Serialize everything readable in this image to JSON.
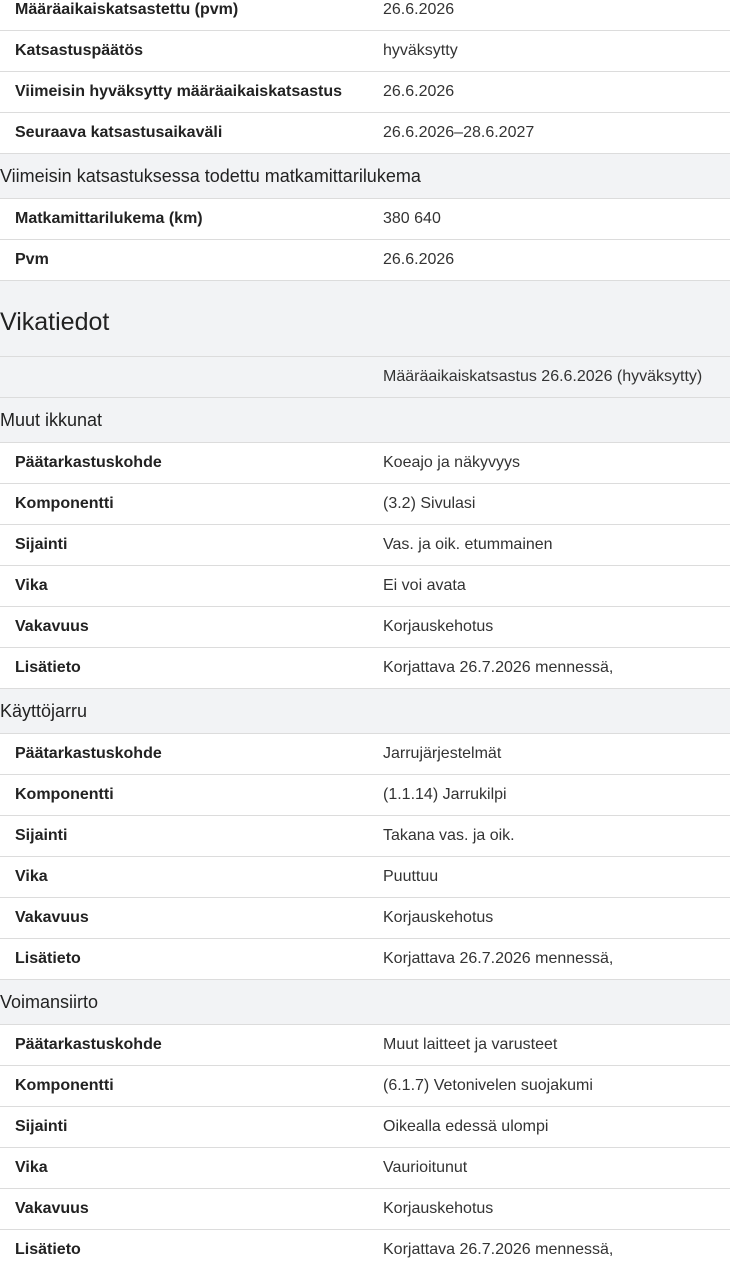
{
  "inspection": {
    "rows": [
      {
        "label": "Määräaikaiskatsastettu (pvm)",
        "value": "26.6.2026"
      },
      {
        "label": "Katsastuspäätös",
        "value": "hyväksytty"
      },
      {
        "label": "Viimeisin hyväksytty määräaikaiskatsastus",
        "value": "26.6.2026"
      },
      {
        "label": "Seuraava katsastusaikaväli",
        "value": "26.6.2026–28.6.2027"
      }
    ]
  },
  "odometer": {
    "title": "Viimeisin katsastuksessa todettu matkamittarilukema",
    "rows": [
      {
        "label": "Matkamittarilukema (km)",
        "value": "380 640"
      },
      {
        "label": "Pvm",
        "value": "26.6.2026"
      }
    ]
  },
  "faults": {
    "title": "Vikatiedot",
    "inspection_label": "Määräaikaiskatsastus 26.6.2026 (hyväksytty)",
    "groups": [
      {
        "title": "Muut ikkunat",
        "rows": [
          {
            "label": "Päätarkastuskohde",
            "value": "Koeajo ja näkyvyys"
          },
          {
            "label": "Komponentti",
            "value": "(3.2) Sivulasi"
          },
          {
            "label": "Sijainti",
            "value": "Vas. ja oik. etummainen"
          },
          {
            "label": "Vika",
            "value": "Ei voi avata"
          },
          {
            "label": "Vakavuus",
            "value": "Korjauskehotus"
          },
          {
            "label": "Lisätieto",
            "value": "Korjattava 26.7.2026 mennessä,"
          }
        ]
      },
      {
        "title": "Käyttöjarru",
        "rows": [
          {
            "label": "Päätarkastuskohde",
            "value": "Jarrujärjestelmät"
          },
          {
            "label": "Komponentti",
            "value": "(1.1.14) Jarrukilpi"
          },
          {
            "label": "Sijainti",
            "value": "Takana vas. ja oik."
          },
          {
            "label": "Vika",
            "value": "Puuttuu"
          },
          {
            "label": "Vakavuus",
            "value": "Korjauskehotus"
          },
          {
            "label": "Lisätieto",
            "value": "Korjattava 26.7.2026 mennessä,"
          }
        ]
      },
      {
        "title": "Voimansiirto",
        "rows": [
          {
            "label": "Päätarkastuskohde",
            "value": "Muut laitteet ja varusteet"
          },
          {
            "label": "Komponentti",
            "value": "(6.1.7) Vetonivelen suojakumi"
          },
          {
            "label": "Sijainti",
            "value": "Oikealla edessä ulompi"
          },
          {
            "label": "Vika",
            "value": "Vaurioitunut"
          },
          {
            "label": "Vakavuus",
            "value": "Korjauskehotus"
          },
          {
            "label": "Lisätieto",
            "value": "Korjattava 26.7.2026 mennessä,"
          }
        ]
      }
    ]
  }
}
